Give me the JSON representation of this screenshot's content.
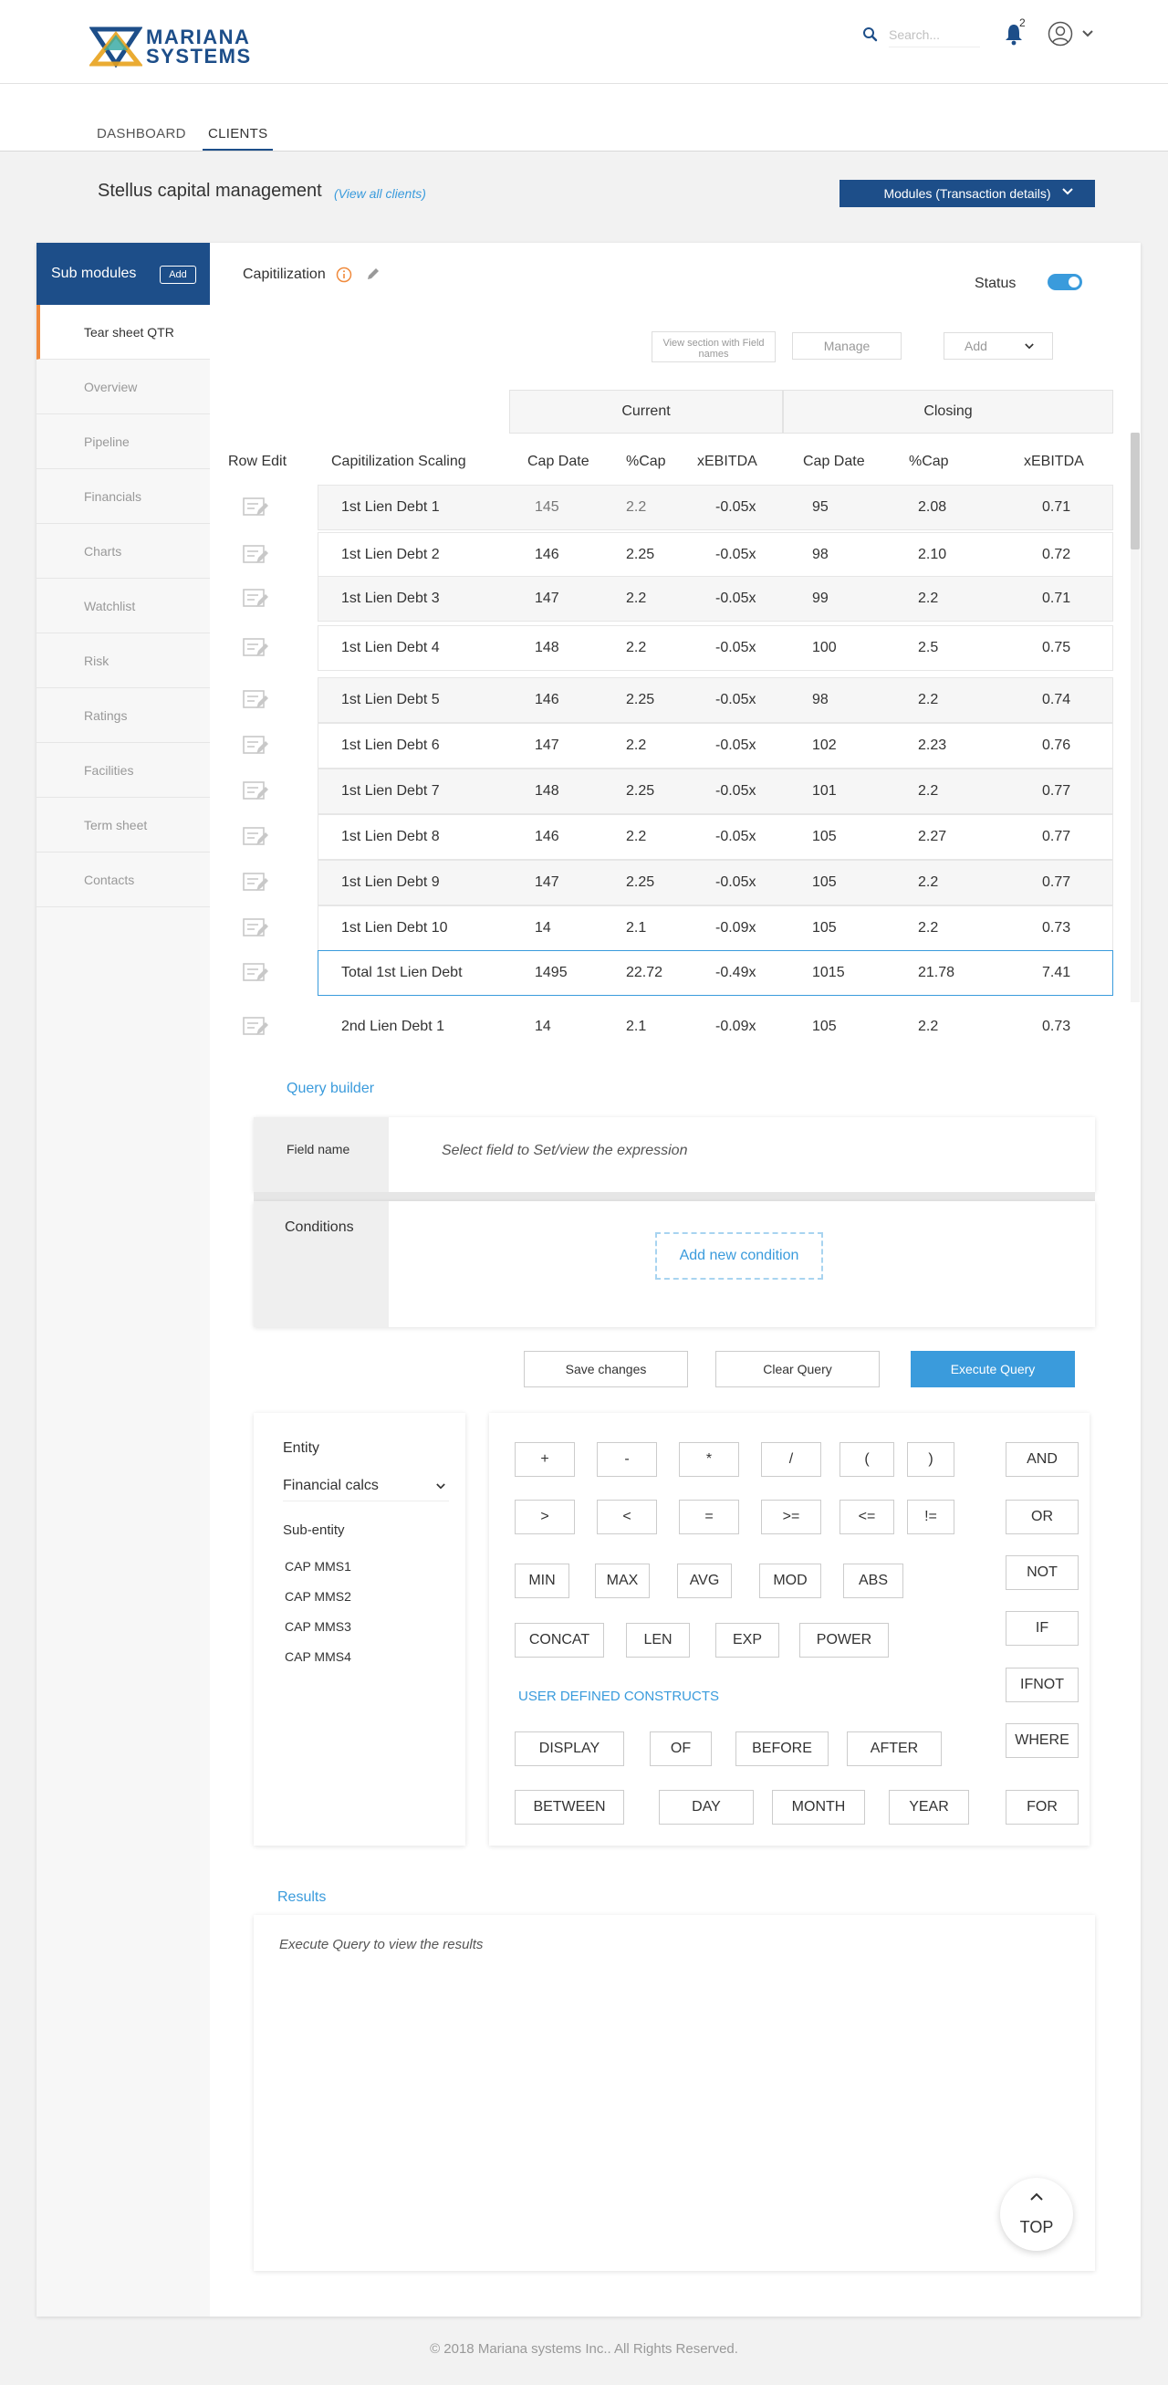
{
  "brand": {
    "line1": "MARIANA",
    "line2": "SYSTEMS"
  },
  "header": {
    "search_placeholder": "Search...",
    "notification_count": "2"
  },
  "nav": {
    "dashboard": "DASHBOARD",
    "clients": "CLIENTS"
  },
  "client": {
    "name": "Stellus capital management",
    "view_all": "(View all clients)",
    "modules_label": "Modules  (Transaction details)"
  },
  "sidebar": {
    "title": "Sub modules",
    "add_label": "Add",
    "items": [
      "Tear sheet QTR",
      "Overview",
      "Pipeline",
      "Financials",
      "Charts",
      "Watchlist",
      "Risk",
      "Ratings",
      "Facilities",
      "Term sheet",
      "Contacts"
    ]
  },
  "section": {
    "title": "Capitilization",
    "status_label": "Status",
    "status_on": true,
    "view_section_btn": "View section with Field names",
    "manage_btn": "Manage",
    "add_btn": "Add"
  },
  "table": {
    "groups": {
      "current": "Current",
      "closing": "Closing"
    },
    "columns": [
      "Row Edit",
      "Capitilization Scaling",
      "Cap Date",
      "%Cap",
      "xEBITDA",
      "Cap Date",
      "%Cap",
      "xEBITDA"
    ],
    "rows": [
      {
        "name": "1st Lien Debt 1",
        "cur_date": "145",
        "cur_cap": "2.2",
        "cur_ebitda": "-0.05x",
        "clo_date": "95",
        "clo_cap": "2.08",
        "clo_ebitda": "0.71"
      },
      {
        "name": "1st Lien Debt 2",
        "cur_date": "146",
        "cur_cap": "2.25",
        "cur_ebitda": "-0.05x",
        "clo_date": "98",
        "clo_cap": "2.10",
        "clo_ebitda": "0.72"
      },
      {
        "name": "1st Lien Debt 3",
        "cur_date": "147",
        "cur_cap": "2.2",
        "cur_ebitda": "-0.05x",
        "clo_date": "99",
        "clo_cap": "2.2",
        "clo_ebitda": "0.71"
      },
      {
        "name": "1st Lien Debt 4",
        "cur_date": "148",
        "cur_cap": "2.2",
        "cur_ebitda": "-0.05x",
        "clo_date": "100",
        "clo_cap": "2.5",
        "clo_ebitda": "0.75"
      },
      {
        "name": "1st Lien Debt 5",
        "cur_date": "146",
        "cur_cap": "2.25",
        "cur_ebitda": "-0.05x",
        "clo_date": "98",
        "clo_cap": "2.2",
        "clo_ebitda": "0.74"
      },
      {
        "name": "1st Lien Debt 6",
        "cur_date": "147",
        "cur_cap": "2.2",
        "cur_ebitda": "-0.05x",
        "clo_date": "102",
        "clo_cap": "2.23",
        "clo_ebitda": "0.76"
      },
      {
        "name": "1st Lien Debt 7",
        "cur_date": "148",
        "cur_cap": "2.25",
        "cur_ebitda": "-0.05x",
        "clo_date": "101",
        "clo_cap": "2.2",
        "clo_ebitda": "0.77"
      },
      {
        "name": "1st Lien Debt 8",
        "cur_date": "146",
        "cur_cap": "2.2",
        "cur_ebitda": "-0.05x",
        "clo_date": "105",
        "clo_cap": "2.27",
        "clo_ebitda": "0.77"
      },
      {
        "name": "1st Lien Debt 9",
        "cur_date": "147",
        "cur_cap": "2.25",
        "cur_ebitda": "-0.05x",
        "clo_date": "105",
        "clo_cap": "2.2",
        "clo_ebitda": "0.77"
      },
      {
        "name": "1st Lien Debt 10",
        "cur_date": "14",
        "cur_cap": "2.1",
        "cur_ebitda": "-0.09x",
        "clo_date": "105",
        "clo_cap": "2.2",
        "clo_ebitda": "0.73"
      },
      {
        "name": "Total 1st Lien Debt",
        "cur_date": "1495",
        "cur_cap": "22.72",
        "cur_ebitda": "-0.49x",
        "clo_date": "1015",
        "clo_cap": "21.78",
        "clo_ebitda": "7.41"
      },
      {
        "name": "2nd Lien Debt 1",
        "cur_date": "14",
        "cur_cap": "2.1",
        "cur_ebitda": "-0.09x",
        "clo_date": "105",
        "clo_cap": "2.2",
        "clo_ebitda": "0.73"
      }
    ]
  },
  "query": {
    "title": "Query builder",
    "field_name_label": "Field name",
    "field_placeholder": "Select field to Set/view the expression",
    "conditions_label": "Conditions",
    "add_condition": "Add new condition",
    "save_btn": "Save changes",
    "clear_btn": "Clear Query",
    "execute_btn": "Execute Query"
  },
  "entity": {
    "title": "Entity",
    "select_value": "Financial calcs",
    "sub_title": "Sub-entity",
    "sub_items": [
      "CAP MMS1",
      "CAP MMS2",
      "CAP MMS3",
      "CAP MMS4"
    ]
  },
  "operators": {
    "arith": [
      "+",
      "-",
      "*",
      "/",
      "(",
      ")"
    ],
    "compare": [
      ">",
      "<",
      "=",
      ">=",
      "<=",
      "!="
    ],
    "funcs": [
      "MIN",
      "MAX",
      "AVG",
      "MOD",
      "ABS"
    ],
    "funcs2": [
      "CONCAT",
      "LEN",
      "EXP",
      "POWER"
    ],
    "udc_label": "USER DEFINED CONSTRUCTS",
    "udc1": [
      "DISPLAY",
      "OF",
      "BEFORE",
      "AFTER"
    ],
    "udc2": [
      "BETWEEN",
      "DAY",
      "MONTH",
      "YEAR"
    ],
    "logic": [
      "AND",
      "OR",
      "NOT",
      "IF",
      "IFNOT",
      "WHERE",
      "FOR"
    ]
  },
  "results": {
    "title": "Results",
    "placeholder": "Execute Query to view the results"
  },
  "top_btn": "TOP",
  "footer": "© 2018 Mariana systems Inc.. All Rights Reserved."
}
